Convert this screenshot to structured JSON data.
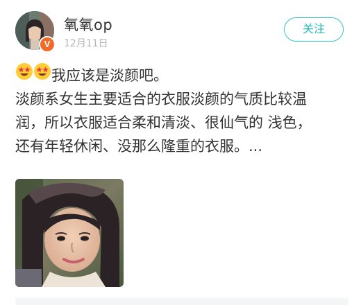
{
  "post": {
    "username": "氧氧op",
    "timestamp": "12月11日",
    "vip_badge": "V",
    "follow_label": "关注",
    "emojis": [
      "star-struck-emoji",
      "star-struck-emoji"
    ],
    "line1_text": "我应该是淡颜吧。",
    "line2": "淡颜系女生主要适合的衣服淡颜的气质比较温",
    "line3": "润，所以衣服适合柔和清淡、很仙气的 浅色，",
    "line4": "还有年轻休闲、没那么隆重的衣服。...",
    "photo_icon": "portrait-photo",
    "colors": {
      "accent": "#33c5c2",
      "text": "#333333",
      "muted": "#b3b3b3",
      "badge": "#f06a2a"
    }
  }
}
